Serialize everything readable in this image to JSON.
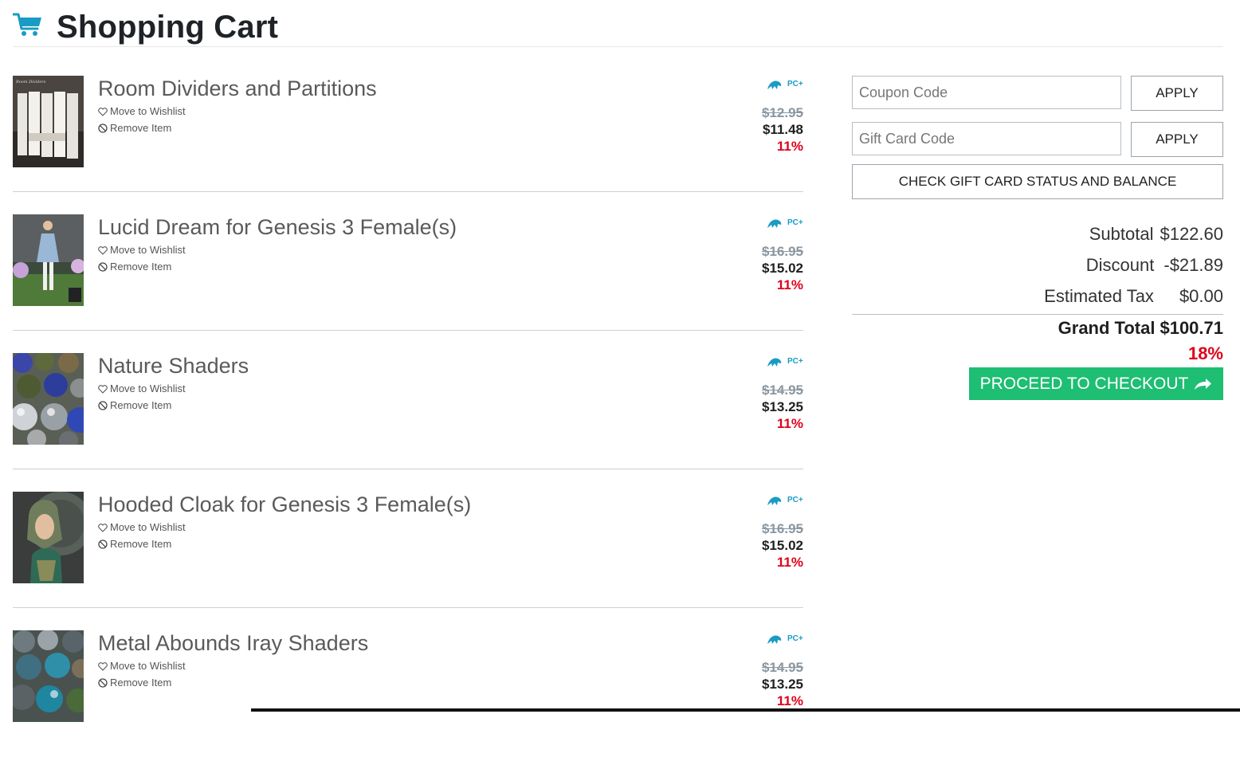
{
  "header": {
    "title": "Shopping Cart",
    "icon": "shopping-cart-icon",
    "icon_color": "#1a9bc4"
  },
  "items": [
    {
      "name": "Room Dividers and Partitions",
      "wishlist_label": "Move to Wishlist",
      "remove_label": "Remove Item",
      "original_price": "$12.95",
      "price": "$11.48",
      "discount": "11%",
      "badge_text": "PC+"
    },
    {
      "name": "Lucid Dream for Genesis 3 Female(s)",
      "wishlist_label": "Move to Wishlist",
      "remove_label": "Remove Item",
      "original_price": "$16.95",
      "price": "$15.02",
      "discount": "11%",
      "badge_text": "PC+"
    },
    {
      "name": "Nature Shaders",
      "wishlist_label": "Move to Wishlist",
      "remove_label": "Remove Item",
      "original_price": "$14.95",
      "price": "$13.25",
      "discount": "11%",
      "badge_text": "PC+"
    },
    {
      "name": "Hooded Cloak for Genesis 3 Female(s)",
      "wishlist_label": "Move to Wishlist",
      "remove_label": "Remove Item",
      "original_price": "$16.95",
      "price": "$15.02",
      "discount": "11%",
      "badge_text": "PC+"
    },
    {
      "name": "Metal Abounds Iray Shaders",
      "wishlist_label": "Move to Wishlist",
      "remove_label": "Remove Item",
      "original_price": "$14.95",
      "price": "$13.25",
      "discount": "11%",
      "badge_text": "PC+"
    }
  ],
  "sidebar": {
    "coupon_placeholder": "Coupon Code",
    "gift_card_placeholder": "Gift Card Code",
    "apply_label": "APPLY",
    "check_gift_label": "CHECK GIFT CARD STATUS AND BALANCE",
    "subtotal_label": "Subtotal",
    "subtotal_value": "$122.60",
    "discount_label": "Discount",
    "discount_value": "-$21.89",
    "tax_label": "Estimated Tax",
    "tax_value": "$0.00",
    "grand_total_label": "Grand Total",
    "grand_total_value": "$100.71",
    "grand_total_discount": "18%",
    "checkout_label": "PROCEED TO CHECKOUT"
  },
  "colors": {
    "accent": "#1ebe73",
    "discount_red": "#e0001b",
    "badge_blue": "#1a9bc4"
  }
}
